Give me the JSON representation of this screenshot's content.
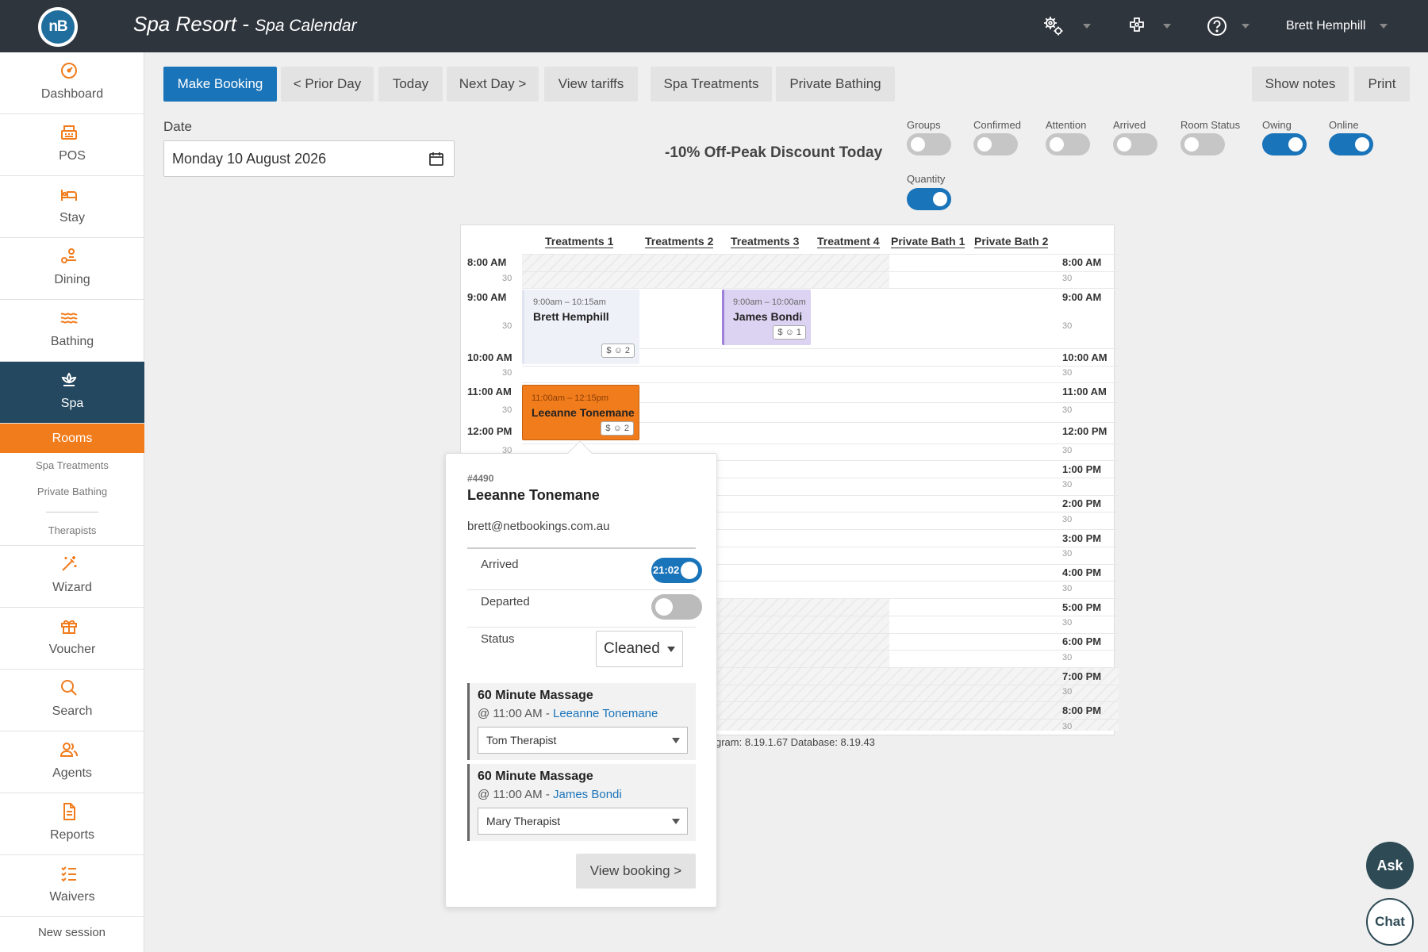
{
  "app": {
    "title": "Spa Resort",
    "separator": " - ",
    "subtitle": "Spa Calendar",
    "logo_text": "nB"
  },
  "header": {
    "user_name": "Brett Hemphill"
  },
  "sidebar": {
    "items": [
      {
        "label": "Dashboard",
        "icon": "dashboard-icon"
      },
      {
        "label": "POS",
        "icon": "register-icon"
      },
      {
        "label": "Stay",
        "icon": "bed-icon"
      },
      {
        "label": "Dining",
        "icon": "dining-icon"
      },
      {
        "label": "Bathing",
        "icon": "waves-icon"
      },
      {
        "label": "Spa",
        "icon": "lotus-icon"
      },
      {
        "label": "Wizard",
        "icon": "magic-wand-icon"
      },
      {
        "label": "Voucher",
        "icon": "gift-icon"
      },
      {
        "label": "Search",
        "icon": "search-icon"
      },
      {
        "label": "Agents",
        "icon": "agents-icon"
      },
      {
        "label": "Reports",
        "icon": "document-icon"
      },
      {
        "label": "Waivers",
        "icon": "checklist-icon"
      }
    ],
    "sub": {
      "rooms": "Rooms",
      "spa_treatments": "Spa Treatments",
      "private_bathing": "Private Bathing",
      "therapists": "Therapists"
    },
    "new_session": "New session",
    "accent": "#f17c1c",
    "active_bg": "#23485f"
  },
  "toolbar": {
    "make_booking": "Make Booking",
    "prior_day": "< Prior Day",
    "today": "Today",
    "next_day": "Next Day >",
    "view_tariffs": "View tariffs",
    "spa_treatments": "Spa Treatments",
    "private_bathing": "Private Bathing",
    "show_notes": "Show notes",
    "print": "Print"
  },
  "date": {
    "label": "Date",
    "value": "Monday 10 August 2026"
  },
  "discount": "-10% Off-Peak Discount Today",
  "filters": [
    {
      "label": "Groups",
      "on": false
    },
    {
      "label": "Confirmed",
      "on": false
    },
    {
      "label": "Attention",
      "on": false
    },
    {
      "label": "Arrived",
      "on": false
    },
    {
      "label": "Room Status",
      "on": false
    },
    {
      "label": "Owing",
      "on": true
    },
    {
      "label": "Online",
      "on": true
    },
    {
      "label": "Quantity",
      "on": true
    }
  ],
  "calendar": {
    "columns": [
      "Treatments 1",
      "Treatments 2",
      "Treatments 3",
      "Treatment 4",
      "Private Bath 1",
      "Private Bath 2"
    ],
    "hours": [
      "8:00 AM",
      "9:00 AM",
      "10:00 AM",
      "11:00 AM",
      "12:00 PM",
      "1:00 PM",
      "2:00 PM",
      "3:00 PM",
      "4:00 PM",
      "5:00 PM",
      "6:00 PM",
      "7:00 PM",
      "8:00 PM"
    ],
    "half": "30",
    "appointments": [
      {
        "time": "9:00am – 10:15am",
        "name": "Brett Hemphill",
        "count": "2"
      },
      {
        "time": "9:00am – 10:00am",
        "name": "James Bondi",
        "count": "1"
      },
      {
        "time": "11:00am – 12:15pm",
        "name": "Leeanne Tonemane",
        "count": "2"
      }
    ]
  },
  "version": "gram: 8.19.1.67 Database: 8.19.43",
  "popup": {
    "booking_id": "#4490",
    "guest": "Leeanne Tonemane",
    "email": "brett@netbookings.com.au",
    "arrived_label": "Arrived",
    "arrived_time": "21:02",
    "departed_label": "Departed",
    "status_label": "Status",
    "status_value": "Cleaned",
    "services": [
      {
        "name": "60 Minute Massage",
        "at": "@ 11:00 AM - ",
        "person": "Leeanne Tonemane",
        "therapist": "Tom Therapist"
      },
      {
        "name": "60 Minute Massage",
        "at": "@ 11:00 AM - ",
        "person": "James Bondi",
        "therapist": "Mary Therapist"
      }
    ],
    "view_booking": "View booking >"
  },
  "fab": {
    "ask": "Ask",
    "chat": "Chat"
  }
}
